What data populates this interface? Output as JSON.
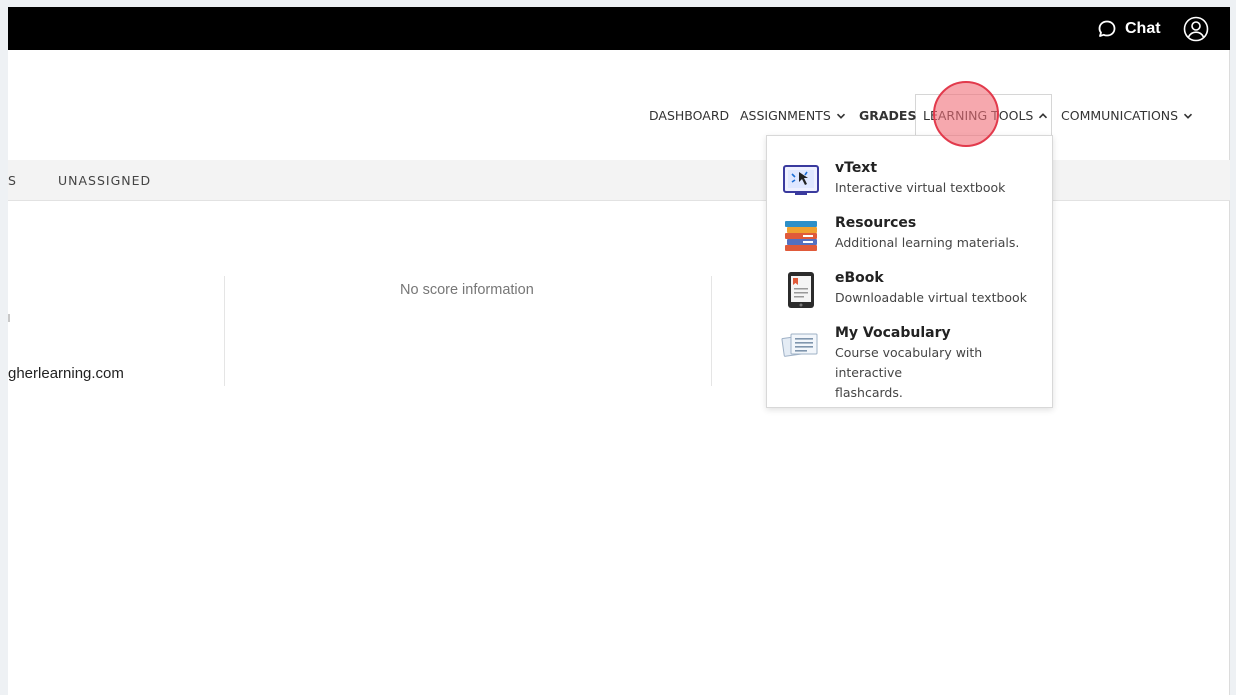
{
  "topbar": {
    "chat_label": "Chat",
    "chat_icon": "chat-bubble-icon",
    "user_icon": "user-circle-icon"
  },
  "nav": {
    "items": [
      {
        "label": "DASHBOARD",
        "has_dropdown": false
      },
      {
        "label": "ASSIGNMENTS",
        "has_dropdown": true
      },
      {
        "label": "GRADES",
        "has_dropdown": false,
        "active": true
      },
      {
        "label": "LEARNING TOOLS",
        "has_dropdown": true,
        "open": true
      },
      {
        "label": "COMMUNICATIONS",
        "has_dropdown": true
      }
    ]
  },
  "subtabs": [
    "S",
    "UNASSIGNED"
  ],
  "content": {
    "no_score": "No score information",
    "email_fragment": "gherlearning.com"
  },
  "learning_tools_menu": [
    {
      "title": "vText",
      "desc": [
        "Interactive virtual textbook"
      ],
      "icon": "vtext-icon"
    },
    {
      "title": "Resources",
      "desc": [
        "Additional learning materials."
      ],
      "icon": "books-stack-icon"
    },
    {
      "title": "eBook",
      "desc": [
        "Downloadable virtual textbook"
      ],
      "icon": "tablet-ebook-icon"
    },
    {
      "title": "My Vocabulary",
      "desc": [
        "Course vocabulary with interactive",
        "flashcards."
      ],
      "icon": "flashcards-icon"
    }
  ],
  "colors": {
    "topbar_bg": "#000000",
    "subbar_bg": "#f3f3f3",
    "click_marker": "#e23a4c"
  }
}
